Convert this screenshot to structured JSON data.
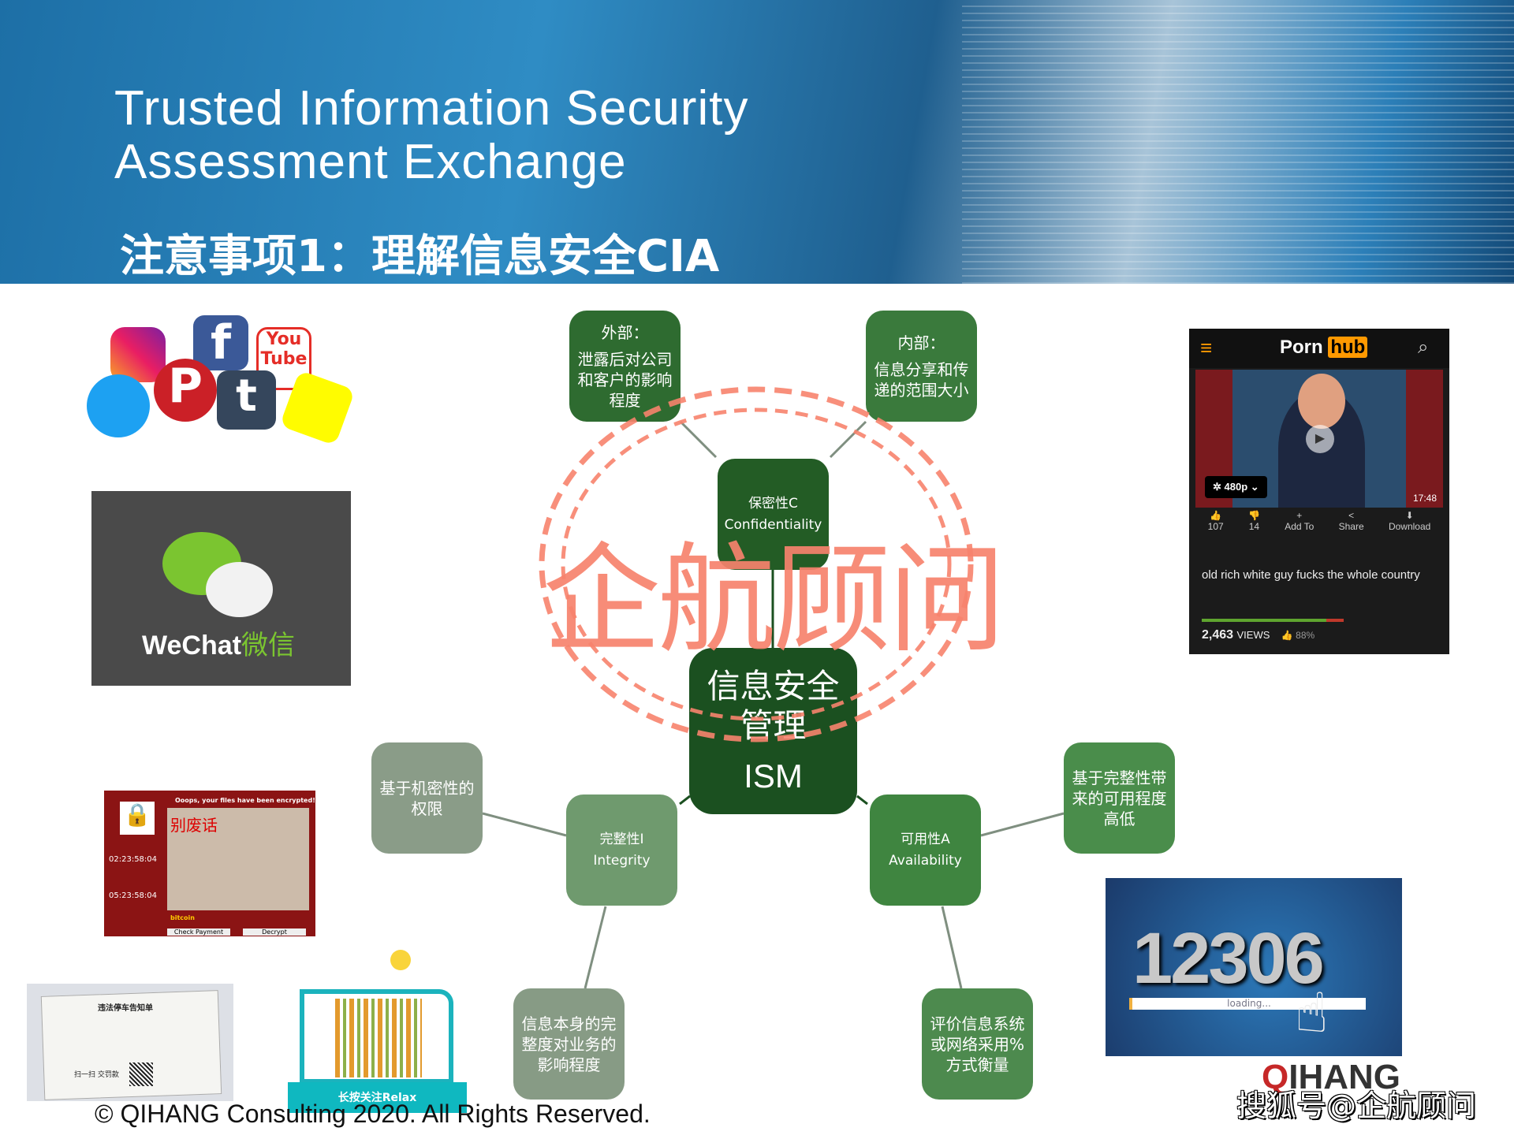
{
  "header": {
    "title_line1": "Trusted Information Security",
    "title_line2": "Assessment Exchange",
    "subtitle": "注意事项1：理解信息安全CIA"
  },
  "diagram": {
    "center": {
      "line1": "信息安全",
      "line2": "管理",
      "line3": "ISM"
    },
    "confidentiality": {
      "cn": "保密性C",
      "en": "Confidentiality"
    },
    "integrity": {
      "cn": "完整性I",
      "en": "Integrity"
    },
    "availability": {
      "cn": "可用性A",
      "en": "Availability"
    },
    "external": {
      "title": "外部：",
      "text": "泄露后对公司和客户的影响程度"
    },
    "internal": {
      "title": "内部：",
      "text": "信息分享和传递的范围大小"
    },
    "conf_permission": "基于机密性的权限",
    "integrity_impact": "信息本身的完整度对业务的影响程度",
    "avail_integrity": "基于完整性带来的可用程度高低",
    "avail_eval": "评价信息系统或网络采用%方式衡量"
  },
  "watermark": "企航顾问",
  "wechat": {
    "brand": "WeChat",
    "brand_cn": "微信"
  },
  "video_app": {
    "logo_a": "Porn",
    "logo_b": "hub",
    "quality": "480p",
    "duration": "17:48",
    "likes": "107",
    "dislikes": "14",
    "add_to": "Add To",
    "share": "Share",
    "download": "Download",
    "title": "old rich white guy fucks the whole country",
    "views": "2,463",
    "views_label": "VIEWS",
    "rating": "88%",
    "rating_fraction": 0.88
  },
  "ransom": {
    "header": "Ooops, your files have been encrypted!",
    "t1": "别废话",
    "timer1": "02:23:58:04",
    "timer2": "05:23:58:04",
    "btn1": "Check Payment",
    "btn2": "Decrypt",
    "bitcoin": "bitcoin"
  },
  "ticket": {
    "title": "违法停车告知单",
    "scan": "扫一扫 交罚款"
  },
  "qr": {
    "caption": "长按关注Relax"
  },
  "railway": {
    "number": "12306",
    "loading": "loading..."
  },
  "logo": {
    "q": "Q",
    "rest": "IHANG"
  },
  "sohu_watermark": "搜狐号@企航顾问",
  "footer": {
    "copyright": "© QIHANG Consulting 2020. All Rights Reserved."
  },
  "colors": {
    "dark_green": "#1b5020",
    "green": "#2e6b30",
    "gray_green": "#8a9c88",
    "watermark": "#f7836d"
  }
}
